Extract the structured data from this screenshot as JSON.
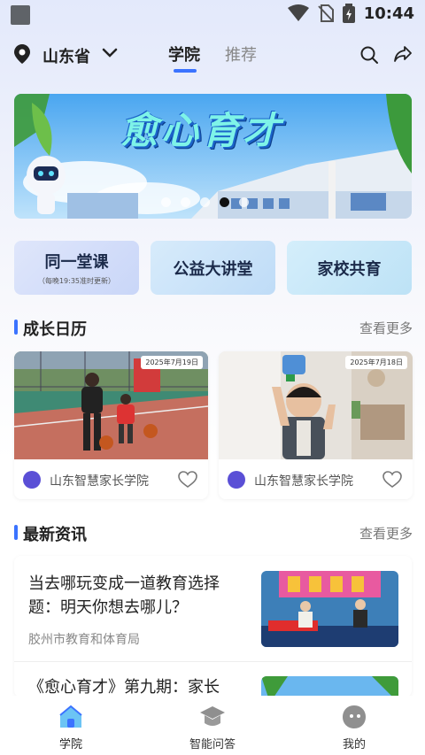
{
  "status_bar": {
    "time": "10:44"
  },
  "header": {
    "location": "山东省",
    "tabs": [
      {
        "label": "学院",
        "active": true
      },
      {
        "label": "推荐",
        "active": false
      }
    ]
  },
  "banner": {
    "title": "愈心育才",
    "dots_total": 5,
    "active_dot": 4
  },
  "features": [
    {
      "label": "同一堂课",
      "sublabel": "（每晚19:35准时更新）"
    },
    {
      "label": "公益大讲堂",
      "sublabel": ""
    },
    {
      "label": "家校共育",
      "sublabel": ""
    }
  ],
  "growth_calendar": {
    "title": "成长日历",
    "more": "查看更多",
    "cards": [
      {
        "date": "2025年7月19日",
        "source": "山东智慧家长学院"
      },
      {
        "date": "2025年7月18日",
        "source": "山东智慧家长学院"
      }
    ]
  },
  "news": {
    "title": "最新资讯",
    "more": "查看更多",
    "items": [
      {
        "title": "当去哪玩变成一道教育选择题：明天你想去哪儿？",
        "source": "胶州市教育和体育局"
      },
      {
        "title": "《愈心育才》第九期：家长",
        "source": ""
      }
    ]
  },
  "bottom_nav": [
    {
      "label": "学院",
      "active": true
    },
    {
      "label": "智能问答",
      "active": false
    },
    {
      "label": "我的",
      "active": false
    }
  ],
  "colors": {
    "accent": "#3b73ff",
    "feature_bg": "#cfe0fb"
  }
}
